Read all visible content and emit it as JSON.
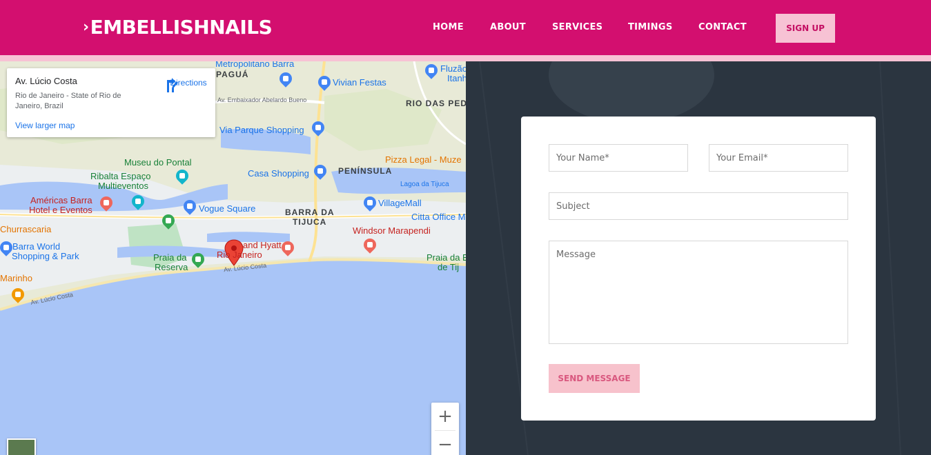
{
  "brand": {
    "logo_text": "EMBELLISHNAILS",
    "logo_mark": "›"
  },
  "nav": {
    "items": [
      {
        "label": "HOME"
      },
      {
        "label": "ABOUT"
      },
      {
        "label": "SERVICES"
      },
      {
        "label": "TIMINGS"
      },
      {
        "label": "CONTACT"
      }
    ],
    "signup_label": "SIGN UP"
  },
  "map": {
    "info_card": {
      "title": "Av. Lúcio Costa",
      "address": "Rio de Janeiro - State of Rio de Janeiro, Brazil",
      "directions_label": "Directions",
      "larger_map_label": "View larger map"
    },
    "labels": {
      "metropolitano": "Metropolitano Barra",
      "pagua": "PAGUÁ",
      "fluzao": "Fluzão",
      "itanh": "Itanh",
      "vivian": "Vivian Festas",
      "embaixador": "Av. Embaixador Abelardo Bueno",
      "rio_das_pedras": "RIO DAS PEDR",
      "via_parque": "Via Parque Shopping",
      "museu": "Museu do Pontal",
      "casa_shopping": "Casa Shopping",
      "peninsula": "PENÍNSULA",
      "pizza": "Pizza Legal - Muze",
      "lagoa": "Lagoa da Tijuca",
      "ribalta_1": "Ribalta Espaço",
      "ribalta_2": "Multieventos",
      "americas_1": "Américas Barra",
      "americas_2": "Hotel e Eventos",
      "vogue": "Vogue Square",
      "barra_1": "BARRA DA",
      "barra_2": "TIJUCA",
      "villagemall": "VillageMall",
      "churrascaria": "Churrascaria",
      "citta": "Citta Office M",
      "windsor": "Windsor Marapendi",
      "barra_world_1": "Barra World",
      "barra_world_2": "Shopping & Park",
      "hyatt_1": "and Hyatt",
      "hyatt_2": "Rio  Janeiro",
      "praia_reserva_1": "Praia da",
      "praia_reserva_2": "Reserva",
      "praia_right_1": "Praia da B",
      "praia_right_2": "de Tij",
      "av_lucio_1": "Av. Lúcio Costa",
      "av_lucio_2": "Av. Lúcio Costa",
      "marinho": "Marinho"
    },
    "zoom_in": "+",
    "zoom_out": "−"
  },
  "form": {
    "name_placeholder": "Your Name*",
    "email_placeholder": "Your Email*",
    "subject_placeholder": "Subject",
    "message_placeholder": "Message",
    "send_label": "SEND MESSAGE"
  },
  "colors": {
    "brand_magenta": "#d30f6f",
    "brand_pink": "#f7c2d4",
    "button_pink": "#f7c2cc"
  }
}
